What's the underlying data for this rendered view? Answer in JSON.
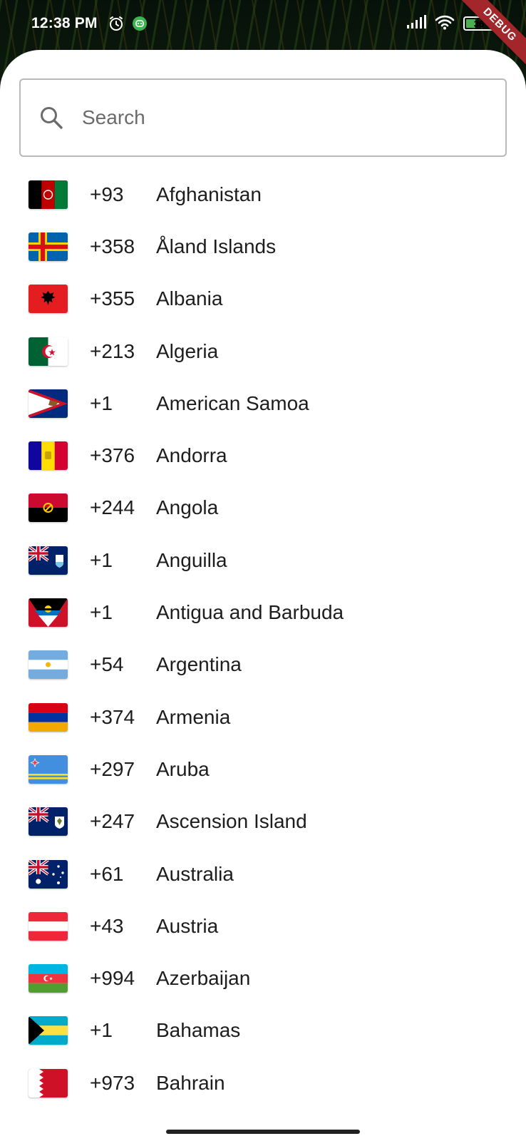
{
  "status_bar": {
    "time": "12:38 PM",
    "battery": "36",
    "battery_fraction": 0.36,
    "icons": [
      "alarm-icon",
      "app-badge-icon",
      "signal-icon",
      "wifi-icon",
      "battery-icon"
    ]
  },
  "debug_banner": "DEBUG",
  "search": {
    "placeholder": "Search",
    "value": ""
  },
  "countries": [
    {
      "code": "+93",
      "name": "Afghanistan",
      "flag": "af"
    },
    {
      "code": "+358",
      "name": "Åland Islands",
      "flag": "ax"
    },
    {
      "code": "+355",
      "name": "Albania",
      "flag": "al"
    },
    {
      "code": "+213",
      "name": "Algeria",
      "flag": "dz"
    },
    {
      "code": "+1",
      "name": "American Samoa",
      "flag": "as"
    },
    {
      "code": "+376",
      "name": "Andorra",
      "flag": "ad"
    },
    {
      "code": "+244",
      "name": "Angola",
      "flag": "ao"
    },
    {
      "code": "+1",
      "name": "Anguilla",
      "flag": "ai"
    },
    {
      "code": "+1",
      "name": "Antigua and Barbuda",
      "flag": "ag"
    },
    {
      "code": "+54",
      "name": "Argentina",
      "flag": "ar"
    },
    {
      "code": "+374",
      "name": "Armenia",
      "flag": "am"
    },
    {
      "code": "+297",
      "name": "Aruba",
      "flag": "aw"
    },
    {
      "code": "+247",
      "name": "Ascension Island",
      "flag": "ac"
    },
    {
      "code": "+61",
      "name": "Australia",
      "flag": "au"
    },
    {
      "code": "+43",
      "name": "Austria",
      "flag": "at"
    },
    {
      "code": "+994",
      "name": "Azerbaijan",
      "flag": "az"
    },
    {
      "code": "+1",
      "name": "Bahamas",
      "flag": "bs"
    },
    {
      "code": "+973",
      "name": "Bahrain",
      "flag": "bh"
    }
  ]
}
